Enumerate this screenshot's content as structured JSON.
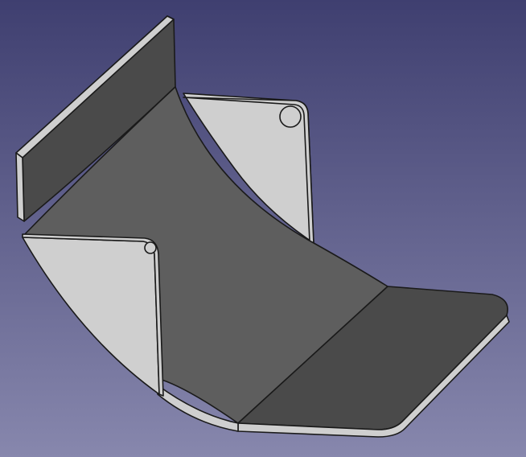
{
  "viewport": {
    "background_top_color": "#3f3f70",
    "background_bottom_color": "#8787ad"
  },
  "model": {
    "type": "sheet-metal-part",
    "colors": {
      "inner_face": "#5e5e5e",
      "dark_face": "#4a4a4a",
      "light_face": "#cfcfcf",
      "edge": "#1a1a1a"
    }
  }
}
